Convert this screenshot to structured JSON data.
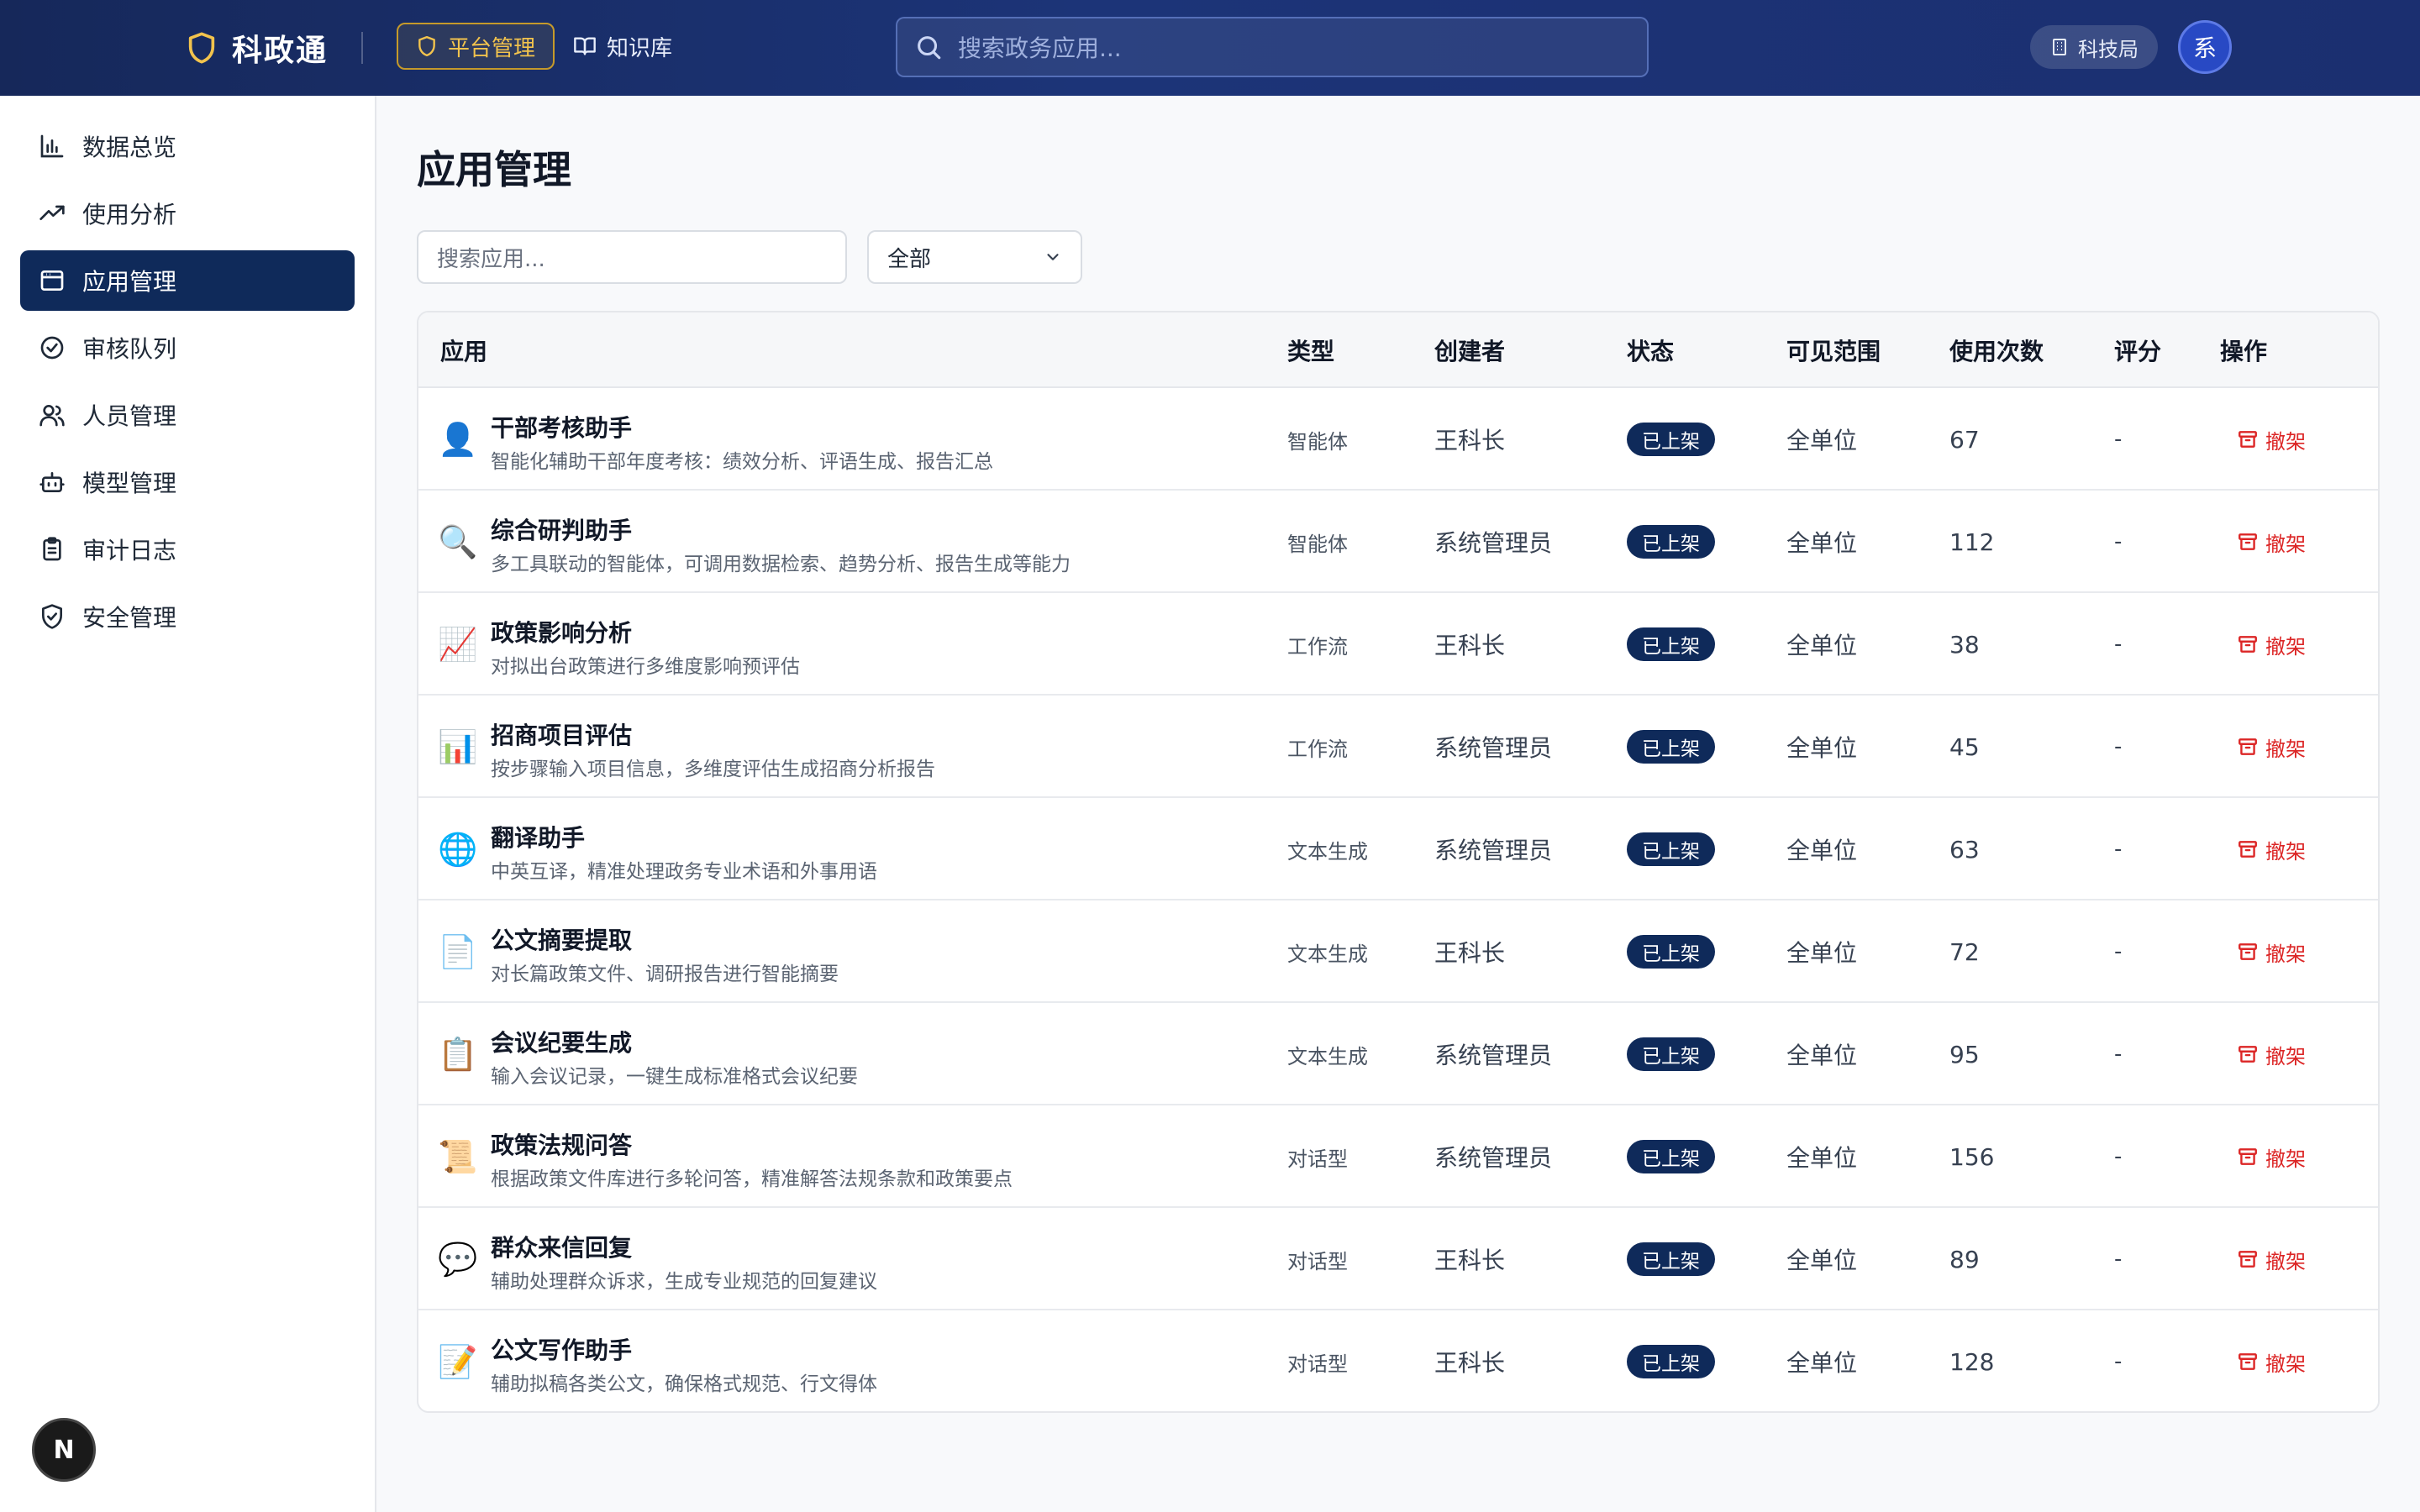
{
  "header": {
    "brand": "科政通",
    "nav_platform": "平台管理",
    "nav_kb": "知识库",
    "search_placeholder": "搜索政务应用...",
    "org": "科技局",
    "avatar": "系"
  },
  "sidebar": {
    "items": [
      {
        "label": "数据总览",
        "icon": "bar-chart-icon"
      },
      {
        "label": "使用分析",
        "icon": "trending-up-icon"
      },
      {
        "label": "应用管理",
        "icon": "app-window-icon",
        "active": true
      },
      {
        "label": "审核队列",
        "icon": "check-circle-icon"
      },
      {
        "label": "人员管理",
        "icon": "users-icon"
      },
      {
        "label": "模型管理",
        "icon": "bot-icon"
      },
      {
        "label": "审计日志",
        "icon": "clipboard-icon"
      },
      {
        "label": "安全管理",
        "icon": "shield-check-icon"
      }
    ],
    "badge": "N"
  },
  "main": {
    "title": "应用管理",
    "search_placeholder": "搜索应用...",
    "filter_value": "全部",
    "columns": {
      "app": "应用",
      "type": "类型",
      "creator": "创建者",
      "status": "状态",
      "scope": "可见范围",
      "uses": "使用次数",
      "rating": "评分",
      "actions": "操作"
    },
    "rows": [
      {
        "icon": "👤",
        "name": "干部考核助手",
        "desc": "智能化辅助干部年度考核：绩效分析、评语生成、报告汇总",
        "type": "智能体",
        "creator": "王科长",
        "status": "已上架",
        "scope": "全单位",
        "uses": "67",
        "rating": "-",
        "action": "撤架"
      },
      {
        "icon": "🔍",
        "name": "综合研判助手",
        "desc": "多工具联动的智能体，可调用数据检索、趋势分析、报告生成等能力",
        "type": "智能体",
        "creator": "系统管理员",
        "status": "已上架",
        "scope": "全单位",
        "uses": "112",
        "rating": "-",
        "action": "撤架"
      },
      {
        "icon": "📈",
        "name": "政策影响分析",
        "desc": "对拟出台政策进行多维度影响预评估",
        "type": "工作流",
        "creator": "王科长",
        "status": "已上架",
        "scope": "全单位",
        "uses": "38",
        "rating": "-",
        "action": "撤架"
      },
      {
        "icon": "📊",
        "name": "招商项目评估",
        "desc": "按步骤输入项目信息，多维度评估生成招商分析报告",
        "type": "工作流",
        "creator": "系统管理员",
        "status": "已上架",
        "scope": "全单位",
        "uses": "45",
        "rating": "-",
        "action": "撤架"
      },
      {
        "icon": "🌐",
        "name": "翻译助手",
        "desc": "中英互译，精准处理政务专业术语和外事用语",
        "type": "文本生成",
        "creator": "系统管理员",
        "status": "已上架",
        "scope": "全单位",
        "uses": "63",
        "rating": "-",
        "action": "撤架"
      },
      {
        "icon": "📄",
        "name": "公文摘要提取",
        "desc": "对长篇政策文件、调研报告进行智能摘要",
        "type": "文本生成",
        "creator": "王科长",
        "status": "已上架",
        "scope": "全单位",
        "uses": "72",
        "rating": "-",
        "action": "撤架"
      },
      {
        "icon": "📋",
        "name": "会议纪要生成",
        "desc": "输入会议记录，一键生成标准格式会议纪要",
        "type": "文本生成",
        "creator": "系统管理员",
        "status": "已上架",
        "scope": "全单位",
        "uses": "95",
        "rating": "-",
        "action": "撤架"
      },
      {
        "icon": "📜",
        "name": "政策法规问答",
        "desc": "根据政策文件库进行多轮问答，精准解答法规条款和政策要点",
        "type": "对话型",
        "creator": "系统管理员",
        "status": "已上架",
        "scope": "全单位",
        "uses": "156",
        "rating": "-",
        "action": "撤架"
      },
      {
        "icon": "💬",
        "name": "群众来信回复",
        "desc": "辅助处理群众诉求，生成专业规范的回复建议",
        "type": "对话型",
        "creator": "王科长",
        "status": "已上架",
        "scope": "全单位",
        "uses": "89",
        "rating": "-",
        "action": "撤架"
      },
      {
        "icon": "📝",
        "name": "公文写作助手",
        "desc": "辅助拟稿各类公文，确保格式规范、行文得体",
        "type": "对话型",
        "creator": "王科长",
        "status": "已上架",
        "scope": "全单位",
        "uses": "128",
        "rating": "-",
        "action": "撤架"
      }
    ]
  },
  "colors": {
    "header_bg": "#1b2f70",
    "accent_gold": "#f2c34d",
    "active_nav": "#0f2a5a",
    "status_badge": "#0f2a5a",
    "delist_red": "#dc2626"
  }
}
